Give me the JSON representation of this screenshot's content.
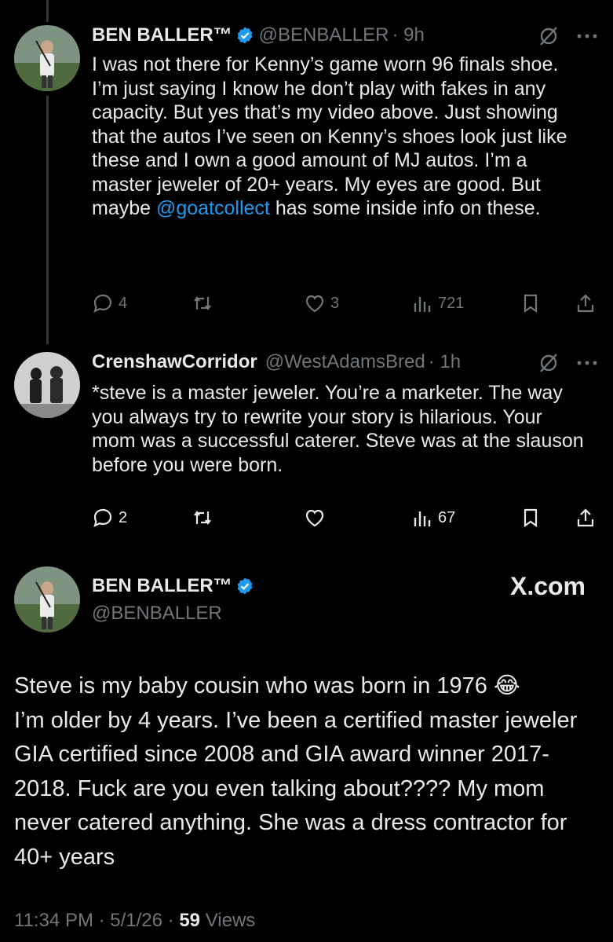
{
  "tweet1": {
    "name": "BEN BALLER™",
    "handle": "@BENBALLER",
    "time": "· 9h",
    "text_before": "I was not there for Kenny’s game worn 96 finals shoe. I’m just saying I know he don’t play with fakes in any capacity. But yes that’s my video above. Just showing that the autos I’ve seen on Kenny’s shoes look just like these and I own a good amount of MJ autos. I’m a master jeweler of 20+ years. My eyes are good. But maybe ",
    "mention": "@goatcollect",
    "text_after": " has some inside info on these.",
    "replies": "4",
    "likes": "3",
    "views": "721"
  },
  "tweet2": {
    "name": "CrenshawCorridor",
    "handle": "@WestAdamsBred",
    "time": "· 1h",
    "text": "*steve is a master jeweler. You’re a marketer. The way you always try to rewrite your story is hilarious. Your mom was a successful caterer. Steve was at the slauson before you were born.",
    "replies": "2",
    "views": "67"
  },
  "tweet3": {
    "name": "BEN BALLER™",
    "handle": "@BENBALLER",
    "brand": "X.com",
    "emoji": "😂",
    "text_line1": "Steve is my baby cousin who was born in 1976",
    "text_rest": "I’m older by 4 years. I’ve been a certified master jeweler GIA certified since 2008 and GIA award winner 2017-2018. Fuck are you even talking about???? My mom never catered anything. She was a dress contractor for 40+ years",
    "timestamp": "11:34 PM · 5/1/26 · ",
    "views_count": "59",
    "views_label": "Views"
  },
  "colors": {
    "accent": "#1d9bf0",
    "muted": "#71767b",
    "text": "#e7e9ea",
    "background": "#000000"
  },
  "icons": [
    "verified-icon",
    "grok-icon",
    "more-icon",
    "reply-icon",
    "retweet-icon",
    "like-icon",
    "views-icon",
    "bookmark-icon",
    "share-icon"
  ]
}
